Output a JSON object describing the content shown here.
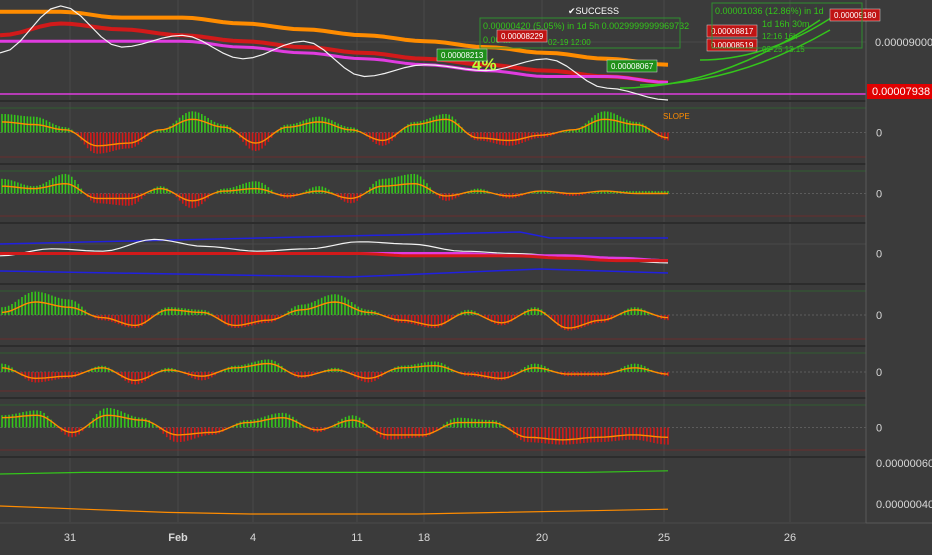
{
  "colors": {
    "background": "#3b3b3b",
    "grid": "#4a4a4a",
    "axis_text": "#d8d8d8",
    "price_tag_bg": "#e00000",
    "bull": "#34c51b",
    "bear": "#d21a1a",
    "orange": "#ff8c00",
    "magenta": "#e03ce0",
    "blue": "#2020e0",
    "success": "#ffffff"
  },
  "annotations": {
    "success_label": "✔SUCCESS",
    "percent_label": "4%",
    "slope_label": "SLOPE",
    "trade_text_1": "0.00000420 (5.05%) in 1d 5h 0.0029999999969732",
    "trade_text_2": "0.00 ...",
    "trade_text_3": "02-19  12:00",
    "trade_text_4": "02-25  13:15",
    "trade_text_5": "0.00001036 (12.86%) in 1d",
    "trade_text_6": "1d 16h 30m",
    "trade_text_7": "12:16 16h",
    "boxes": [
      {
        "text": "0.00008213",
        "kind": "green"
      },
      {
        "text": "0.00008229",
        "kind": "red"
      },
      {
        "text": "0.00008067",
        "kind": "green"
      },
      {
        "text": "0.00008817",
        "kind": "red"
      },
      {
        "text": "0.00008519",
        "kind": "red"
      },
      {
        "text": "0.00009180",
        "kind": "red"
      }
    ]
  },
  "chart_data": {
    "type": "line",
    "x_tick_labels": [
      "31",
      "Feb",
      "4",
      "11",
      "18",
      "20",
      "25",
      "26"
    ],
    "panes": [
      {
        "id": "price",
        "type": "line",
        "ylim": [
          7.9e-06,
          9.6e-06
        ],
        "y_ticks": [
          "0.00009000"
        ],
        "last_price": "0.00007938",
        "series": [
          {
            "color": "orange",
            "values": [
              9.4e-06,
              9.4e-06,
              9.3e-06,
              9.3e-06,
              9.2e-06,
              9.1e-06,
              9e-06,
              8.9e-06,
              8.8e-06,
              8.7e-06,
              8.6e-06,
              8.5e-06
            ]
          },
          {
            "color": "red",
            "values": [
              9e-06,
              9.2e-06,
              9.1e-06,
              9e-06,
              8.9e-06,
              8.8e-06,
              8.7e-06,
              8.6e-06,
              8.5e-06,
              8.4e-06,
              8.3e-06,
              8.2e-06
            ]
          },
          {
            "color": "magenta",
            "values": [
              8.9e-06,
              8.9e-06,
              8.9e-06,
              8.9e-06,
              8.8e-06,
              8.7e-06,
              8.6e-06,
              8.5e-06,
              8.4e-06,
              8.3e-06,
              8.3e-06,
              8.2e-06
            ]
          },
          {
            "color": "white",
            "values": [
              8.7e-06,
              9.5e-06,
              8.8e-06,
              9e-06,
              8.6e-06,
              8.9e-06,
              8.3e-06,
              8.5e-06,
              8.4e-06,
              8.6e-06,
              8.1e-06,
              7.9e-06
            ]
          }
        ]
      },
      {
        "id": "slope",
        "type": "histogram",
        "y_ticks": [
          "0"
        ],
        "values": [
          0.7,
          0.6,
          0.2,
          -0.8,
          -0.6,
          0.1,
          0.8,
          0.3,
          -0.7,
          0.3,
          0.6,
          0.2,
          -0.5,
          0.4,
          0.7,
          -0.3,
          -0.5,
          -0.2,
          0.1,
          0.8,
          0.4,
          -0.3
        ],
        "line": [
          0.4,
          0.3,
          0.1,
          -0.5,
          -0.4,
          0.1,
          0.5,
          0.2,
          -0.4,
          0.2,
          0.4,
          0.1,
          -0.3,
          0.3,
          0.5,
          -0.2,
          -0.3,
          -0.1,
          0.1,
          0.5,
          0.3,
          -0.2
        ]
      },
      {
        "id": "momentum",
        "type": "histogram",
        "y_ticks": [
          "0"
        ],
        "values": [
          0.6,
          0.3,
          0.8,
          -0.4,
          -0.5,
          0.3,
          -0.6,
          0.2,
          0.5,
          -0.2,
          0.3,
          -0.4,
          0.6,
          0.8,
          -0.3,
          0.2,
          -0.2,
          0.1,
          -0.1,
          0.1,
          0.1,
          0.1
        ],
        "line": [
          0.3,
          0.2,
          0.4,
          -0.2,
          -0.2,
          0.2,
          -0.3,
          0.1,
          0.2,
          -0.1,
          0.1,
          -0.2,
          0.3,
          0.4,
          -0.1,
          0.1,
          -0.1,
          0.1,
          0.0,
          0.1,
          0.0,
          0.0
        ]
      },
      {
        "id": "bands",
        "type": "line",
        "y_ticks": [
          "0"
        ],
        "series": [
          {
            "color": "white",
            "values": [
              -0.1,
              0.2,
              0.1,
              0.6,
              0.3,
              0.1,
              0.2,
              0.5,
              0.4,
              0.1,
              0.0,
              -0.1,
              -0.3,
              -0.4
            ]
          },
          {
            "color": "magenta",
            "values": [
              0.0,
              0.0,
              0.0,
              0.0,
              0.0,
              0.0,
              0.0,
              0.0,
              0.0,
              0.0,
              -0.1,
              -0.1,
              -0.2,
              -0.3
            ]
          },
          {
            "color": "red",
            "values": [
              0.0,
              0.0,
              0.0,
              0.0,
              0.0,
              0.0,
              0.0,
              0.0,
              -0.1,
              -0.1,
              -0.1,
              -0.2,
              -0.3,
              -0.3
            ]
          }
        ]
      },
      {
        "id": "osc1",
        "type": "histogram",
        "y_ticks": [
          "0"
        ],
        "values": [
          0.3,
          0.9,
          0.6,
          -0.2,
          -0.5,
          0.3,
          0.2,
          -0.5,
          -0.3,
          0.4,
          0.8,
          0.2,
          -0.3,
          -0.5,
          0.2,
          -0.4,
          0.3,
          -0.6,
          -0.3,
          0.3,
          -0.2
        ],
        "line": [
          0.1,
          0.5,
          0.3,
          -0.1,
          -0.4,
          0.2,
          0.1,
          -0.4,
          -0.2,
          0.2,
          0.5,
          0.1,
          -0.2,
          -0.4,
          0.1,
          -0.3,
          0.2,
          -0.5,
          -0.2,
          0.2,
          -0.1
        ]
      },
      {
        "id": "osc2",
        "type": "histogram",
        "y_ticks": [
          "0"
        ],
        "values": [
          0.4,
          -0.5,
          -0.3,
          0.3,
          -0.6,
          0.2,
          -0.4,
          0.3,
          0.6,
          -0.3,
          0.2,
          -0.5,
          0.3,
          0.5,
          -0.2,
          -0.4,
          0.4,
          -0.2,
          -0.2,
          0.4,
          -0.2
        ],
        "line": [
          0.2,
          -0.3,
          -0.2,
          0.2,
          -0.4,
          0.1,
          -0.2,
          0.2,
          0.4,
          -0.2,
          0.1,
          -0.3,
          0.2,
          0.3,
          -0.1,
          -0.3,
          0.2,
          -0.1,
          -0.1,
          0.2,
          -0.1
        ]
      },
      {
        "id": "osc3",
        "type": "histogram",
        "y_ticks": [
          "0"
        ],
        "values": [
          0.5,
          0.7,
          -0.4,
          0.8,
          0.4,
          -0.6,
          -0.3,
          0.3,
          0.6,
          -0.2,
          0.5,
          -0.5,
          -0.4,
          0.4,
          0.3,
          -0.6,
          -0.7,
          -0.6,
          -0.5,
          -0.7
        ],
        "line": [
          0.4,
          0.5,
          -0.2,
          0.5,
          0.3,
          -0.3,
          -0.2,
          0.2,
          0.4,
          -0.1,
          0.3,
          -0.3,
          -0.3,
          0.2,
          0.2,
          -0.4,
          -0.5,
          -0.4,
          -0.3,
          -0.4
        ]
      },
      {
        "id": "lower",
        "type": "line",
        "ylim": [
          3e-07,
          7e-07
        ],
        "y_ticks": [
          "0.00000060",
          "0.00000040"
        ],
        "series": [
          {
            "color": "green",
            "values": [
              6e-07,
              6.1e-07,
              6.1e-07,
              6.1e-07,
              6.1e-07,
              6.1e-07,
              6.1e-07,
              6.1e-07,
              6.2e-07
            ]
          },
          {
            "color": "orange",
            "values": [
              4e-07,
              3.8e-07,
              3.6e-07,
              3.5e-07,
              3.5e-07,
              3.5e-07,
              3.6e-07,
              3.7e-07,
              3.8e-07
            ]
          }
        ]
      }
    ]
  }
}
